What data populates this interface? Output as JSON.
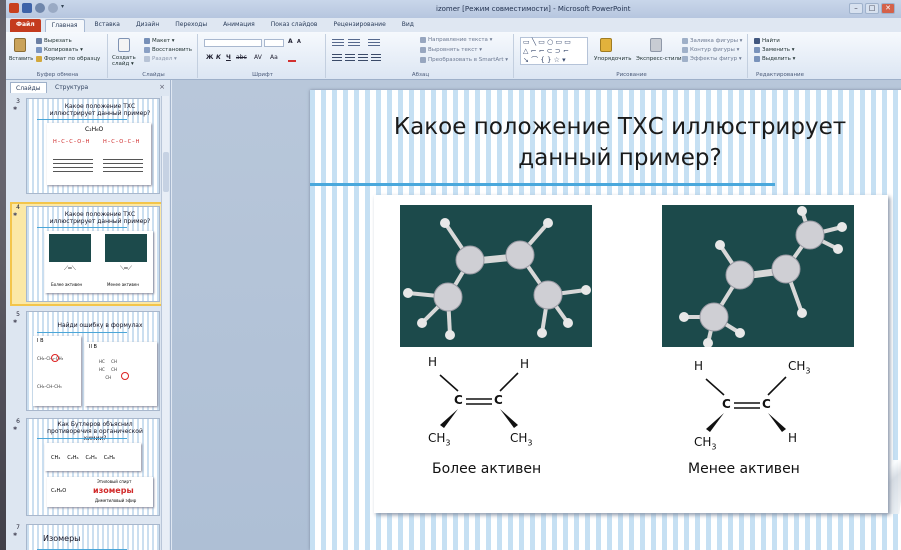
{
  "window": {
    "title": "izomer [Режим совместимости] - Microsoft PowerPoint",
    "controls": [
      "–",
      "□",
      "✕"
    ]
  },
  "ribbon_tabs": [
    "Файл",
    "Главная",
    "Вставка",
    "Дизайн",
    "Переходы",
    "Анимация",
    "Показ слайдов",
    "Рецензирование",
    "Вид"
  ],
  "ribbon": {
    "clipboard": {
      "label": "Буфер обмена",
      "paste": "Вставить",
      "cut": "Вырезать",
      "copy": "Копировать ▾",
      "format": "Формат по образцу"
    },
    "slides": {
      "label": "Слайды",
      "create": "Создать слайд ▾",
      "layout": "Макет ▾",
      "reset": "Восстановить",
      "section": "Раздел ▾"
    },
    "font": {
      "label": "Шрифт",
      "bold": "Ж",
      "italic": "К",
      "underline": "Ч",
      "strike": "abc",
      "spacing": "AV",
      "case": "Aa",
      "grow": "A",
      "shrink": "A"
    },
    "paragraph": {
      "label": "Абзац",
      "direction": "Направление текста ▾",
      "align": "Выровнять текст ▾",
      "smartart": "Преобразовать в SmartArt ▾"
    },
    "drawing": {
      "label": "Рисование",
      "arrange": "Упорядочить",
      "styles": "Экспресс-стили",
      "fill": "Заливка фигуры ▾",
      "outline": "Контур фигуры ▾",
      "effects": "Эффекты фигур ▾"
    },
    "editing": {
      "label": "Редактирование",
      "find": "Найти",
      "replace": "Заменить ▾",
      "select": "Выделить ▾"
    }
  },
  "panel": {
    "tab_slides": "Слайды",
    "tab_outline": "Структура",
    "close": "×"
  },
  "thumbnails": [
    {
      "num": "3",
      "title": "Какое положение ТХС иллюстрирует данный пример?",
      "formula": "C₂H₆O"
    },
    {
      "num": "4",
      "title": "Какое положение ТХС иллюстрирует данный пример?",
      "cap1": "Более активен",
      "cap2": "Менее активен"
    },
    {
      "num": "5",
      "title": "Найди ошибку в формулах",
      "lbl1": "I В",
      "lbl2": "II В"
    },
    {
      "num": "6",
      "title": "Как Бутлеров объяснил противоречия в органической химии?",
      "items": [
        "CH₄",
        "C₂H₆",
        "C₂H₄",
        "C₆H₆"
      ],
      "formula": "C₂H₆O",
      "word": "изомеры",
      "spirt": "Этиловый спирт",
      "efir": "Диметиловый эфир"
    },
    {
      "num": "7",
      "title": "Изомеры"
    }
  ],
  "slide": {
    "title": "Какое положение ТХС иллюстрирует данный пример?",
    "left": {
      "caption": "Более активен",
      "h1": "H",
      "h2": "H",
      "c1": "C",
      "c2": "C",
      "ch3a": "CH",
      "ch3b": "CH",
      "sub": "3"
    },
    "right": {
      "caption": "Менее  активен",
      "h1": "H",
      "h2": "H",
      "c1": "C",
      "c2": "C",
      "ch3a": "CH",
      "ch3b": "CH",
      "sub": "3"
    }
  }
}
